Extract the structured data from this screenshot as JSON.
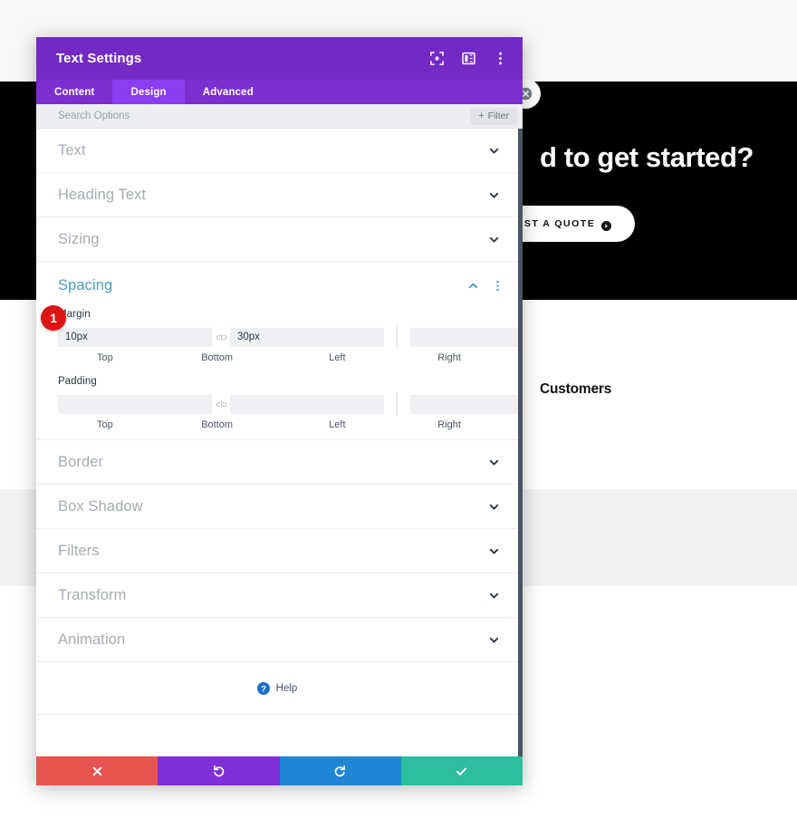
{
  "background_page": {
    "cta_heading": "d to get started?",
    "cta_button_label": "REQUEST A QUOTE",
    "cta_arrow_icon": "arrow-right-circle-icon",
    "customers_label": "Customers",
    "close_icon": "close-circle-icon",
    "colors": {
      "dark_band": "#000000",
      "grey_band": "#f1f2f3",
      "page_bg": "#ffffff"
    }
  },
  "modal": {
    "title": "Text Settings",
    "header_icons": [
      {
        "name": "focus-target-icon"
      },
      {
        "name": "panel-layout-icon"
      },
      {
        "name": "more-vertical-icon"
      }
    ],
    "tabs": [
      {
        "label": "Content",
        "active": false
      },
      {
        "label": "Design",
        "active": true
      },
      {
        "label": "Advanced",
        "active": false
      }
    ],
    "search": {
      "placeholder": "Search Options",
      "value": "",
      "filter_label": "Filter",
      "filter_plus": "+"
    },
    "sections_above": [
      {
        "title": "Text",
        "icon": "chevron-down-icon"
      },
      {
        "title": "Heading Text",
        "icon": "chevron-down-icon"
      },
      {
        "title": "Sizing",
        "icon": "chevron-down-icon"
      }
    ],
    "open_section": {
      "title": "Spacing",
      "collapse_icon": "chevron-up-icon",
      "menu_icon": "more-vertical-icon",
      "badge": "1",
      "groups": [
        {
          "label": "Margin",
          "link_icon": "link-broken-icon",
          "fields": [
            {
              "side": "Top",
              "value": "10px"
            },
            {
              "side": "Bottom",
              "value": "30px"
            },
            {
              "side": "Left",
              "value": ""
            },
            {
              "side": "Right",
              "value": ""
            }
          ]
        },
        {
          "label": "Padding",
          "link_icon": "link-broken-icon",
          "fields": [
            {
              "side": "Top",
              "value": ""
            },
            {
              "side": "Bottom",
              "value": ""
            },
            {
              "side": "Left",
              "value": ""
            },
            {
              "side": "Right",
              "value": ""
            }
          ]
        }
      ]
    },
    "sections_below": [
      {
        "title": "Border",
        "icon": "chevron-down-icon"
      },
      {
        "title": "Box Shadow",
        "icon": "chevron-down-icon"
      },
      {
        "title": "Filters",
        "icon": "chevron-down-icon"
      },
      {
        "title": "Transform",
        "icon": "chevron-down-icon"
      },
      {
        "title": "Animation",
        "icon": "chevron-down-icon"
      }
    ],
    "help": {
      "label": "Help",
      "icon": "help-circle-icon"
    },
    "footer_buttons": [
      {
        "name": "discard-button",
        "icon": "close-x-icon",
        "color": "#e8544f"
      },
      {
        "name": "undo-button",
        "icon": "undo-icon",
        "color": "#7f2fd6"
      },
      {
        "name": "redo-button",
        "icon": "redo-icon",
        "color": "#1e86d4"
      },
      {
        "name": "save-button",
        "icon": "checkmark-icon",
        "color": "#2bbf9e"
      }
    ],
    "colors": {
      "header": "#7329c4",
      "tab_bar": "#7a2fce",
      "tab_active": "#8a3ef0",
      "section_open_title": "#4c9bc6",
      "badge": "#dd1414"
    }
  }
}
